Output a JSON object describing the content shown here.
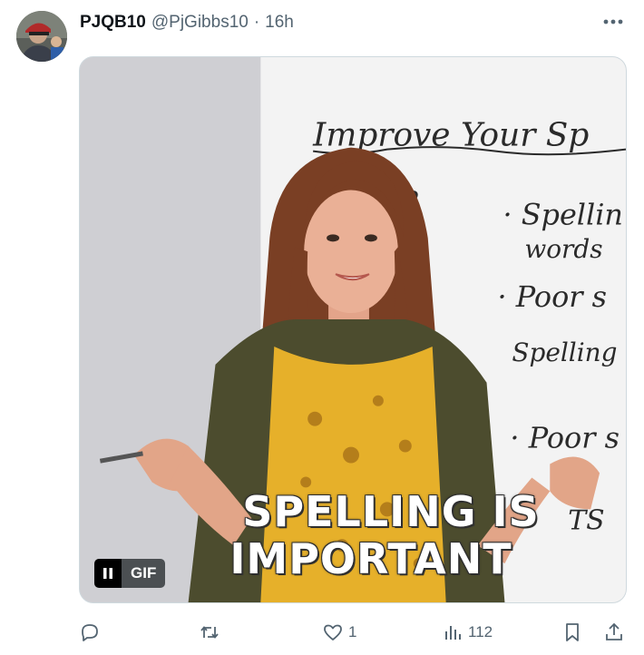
{
  "tweet": {
    "display_name": "PJQB10",
    "handle": "@PjGibbs10",
    "separator": "·",
    "time": "16h"
  },
  "media": {
    "type": "GIF",
    "caption_line1": "SPELLING IS",
    "caption_line2": "IMPORTANT",
    "gif_badge": "GIF",
    "whiteboard_text": [
      "Improve Your Sp",
      "?",
      "· Spellin",
      "words",
      "· Poor s",
      "Spelling",
      "· Poor s",
      "TS"
    ]
  },
  "actions": {
    "reply_count": "",
    "retweet_count": "",
    "like_count": "1",
    "views_count": "112"
  },
  "icons": [
    "more-icon",
    "reply-icon",
    "retweet-icon",
    "like-icon",
    "views-icon",
    "bookmark-icon",
    "share-icon",
    "pause-icon"
  ],
  "colors": {
    "secondary_text": "#536471",
    "primary_text": "#0f1419",
    "dress": "#e8b52c",
    "cardigan": "#4a4a2c"
  }
}
